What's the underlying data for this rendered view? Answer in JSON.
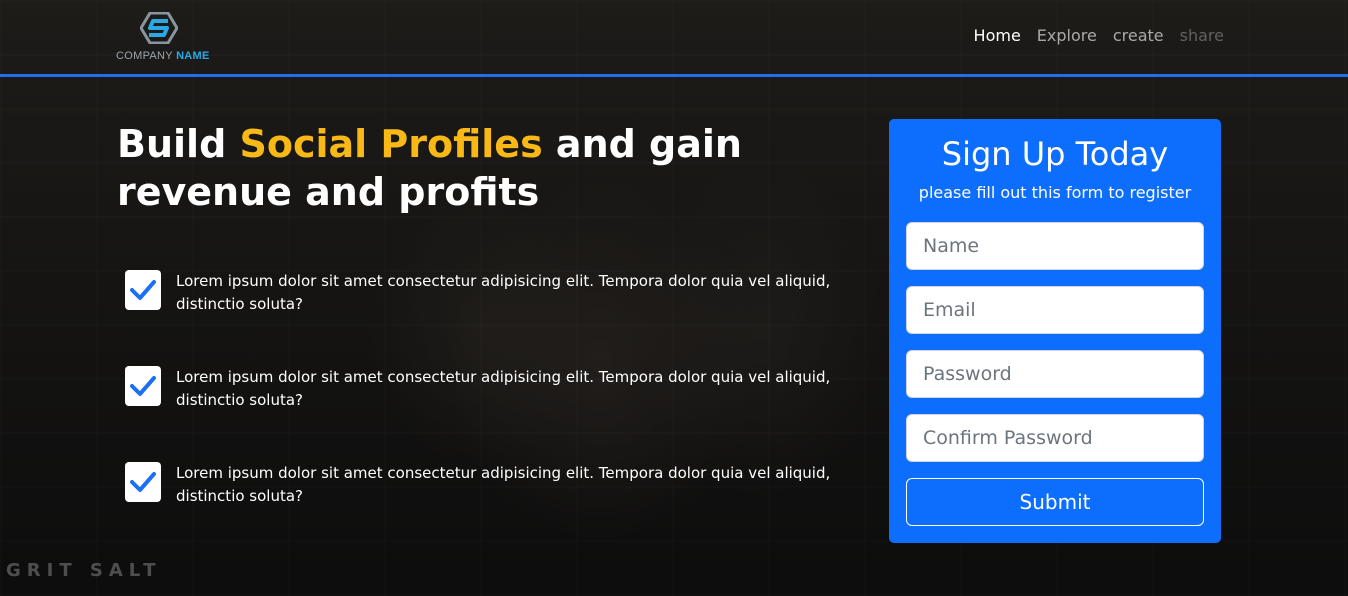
{
  "brand": {
    "name_part1": "COMPANY",
    "name_part2": "NAME",
    "logo_icon": "hexagon-s-logo"
  },
  "nav": {
    "items": [
      "Home",
      "Explore",
      "create",
      "share"
    ]
  },
  "hero": {
    "title_before": "Build ",
    "title_highlight": "Social Profiles",
    "title_after": " and gain revenue and profits"
  },
  "features": [
    {
      "icon": "checkbox-icon",
      "text": "Lorem ipsum dolor sit amet consectetur adipisicing elit. Tempora dolor quia vel aliquid, distinctio soluta?"
    },
    {
      "icon": "checkbox-icon",
      "text": "Lorem ipsum dolor sit amet consectetur adipisicing elit. Tempora dolor quia vel aliquid, distinctio soluta?"
    },
    {
      "icon": "checkbox-icon",
      "text": "Lorem ipsum dolor sit amet consectetur adipisicing elit. Tempora dolor quia vel aliquid, distinctio soluta?"
    }
  ],
  "signup": {
    "title": "Sign Up Today",
    "subtitle": "please fill out this form to register",
    "name_placeholder": "Name",
    "email_placeholder": "Email",
    "password_placeholder": "Password",
    "confirm_placeholder": "Confirm Password",
    "submit_label": "Submit"
  },
  "background": {
    "sign_text": "GRIT SALT"
  },
  "colors": {
    "accent": "#1e6ff0",
    "highlight": "#f8b916",
    "form_bg": "#0d6efd"
  }
}
